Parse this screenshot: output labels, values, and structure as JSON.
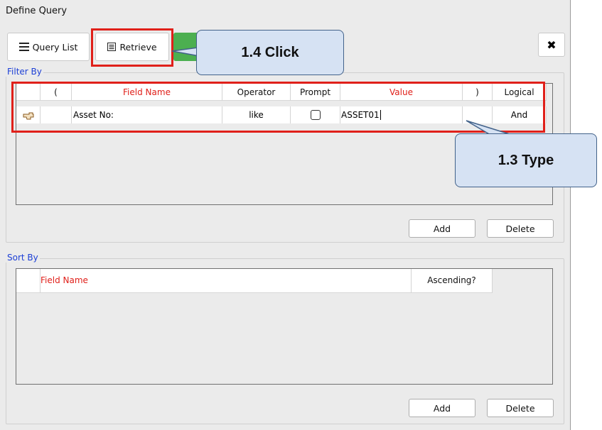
{
  "window": {
    "title": "Define Query"
  },
  "toolbar": {
    "query_list_label": "Query List",
    "retrieve_label": "Retrieve",
    "close_icon": "✖"
  },
  "filter_by": {
    "label": "Filter By",
    "columns": {
      "open_paren": "(",
      "field_name": "Field Name",
      "operator": "Operator",
      "prompt": "Prompt",
      "value": "Value",
      "close_paren": ")",
      "logical": "Logical"
    },
    "row": {
      "open_paren": "",
      "field_name": "Asset No:",
      "operator": "like",
      "prompt": false,
      "value": "ASSET01",
      "close_paren": "",
      "logical": "And"
    },
    "add_label": "Add",
    "delete_label": "Delete"
  },
  "sort_by": {
    "label": "Sort By",
    "columns": {
      "field_name": "Field Name",
      "ascending": "Ascending?"
    },
    "add_label": "Add",
    "delete_label": "Delete"
  },
  "annotations": {
    "click_callout": "1.4 Click",
    "type_callout": "1.3 Type"
  },
  "colors": {
    "highlight_red": "#e0201a",
    "callout_fill": "#d6e2f3",
    "callout_border": "#42628a",
    "group_label_blue": "#1c3fd6",
    "header_required_red": "#e0201a",
    "green_button": "#4caf50"
  },
  "icons": {
    "query_list": "list-icon",
    "retrieve": "document-list-icon",
    "close": "close-icon",
    "row_pointer": "pointing-hand-icon"
  }
}
